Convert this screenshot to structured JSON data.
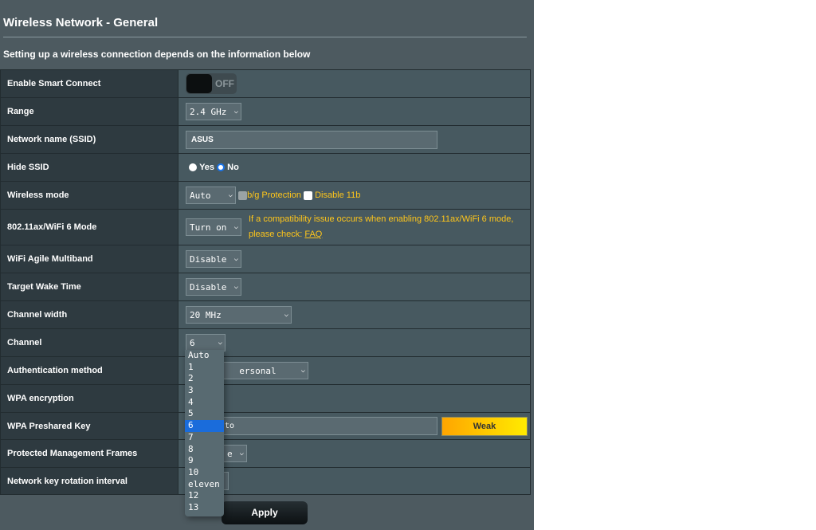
{
  "page": {
    "title": "Wireless Network - General",
    "subtitle": "Setting up a wireless connection depends on the information below"
  },
  "rows": {
    "smart_connect": {
      "label": "Enable Smart Connect",
      "toggle": "OFF",
      "on": false
    },
    "range": {
      "label": "Range",
      "value": "2.4 GHz"
    },
    "ssid": {
      "label": "Network name (SSID)",
      "value": "ASUS"
    },
    "hide_ssid": {
      "label": "Hide SSID",
      "yes": "Yes",
      "no": "No",
      "selected": "No"
    },
    "wireless_mode": {
      "label": "Wireless mode",
      "value": "Auto",
      "bg_protection": "b/g Protection",
      "bg_checked": true,
      "disable11b": "Disable 11b",
      "disable11b_checked": false
    },
    "ax_mode": {
      "label": "802.11ax/WiFi 6 Mode",
      "value": "Turn on",
      "note": "If a compatibility issue occurs when enabling 802.11ax/WiFi 6 mode,",
      "note2": "please check: ",
      "faq": "FAQ"
    },
    "agile": {
      "label": "WiFi Agile Multiband",
      "value": "Disable"
    },
    "twt": {
      "label": "Target Wake Time",
      "value": "Disable"
    },
    "width": {
      "label": "Channel width",
      "value": "20 MHz"
    },
    "channel": {
      "label": "Channel",
      "value": "6"
    },
    "auth": {
      "label": "Authentication method",
      "value": "ersonal"
    },
    "wpa_enc": {
      "label": "WPA encryption"
    },
    "psk": {
      "label": "WPA Preshared Key",
      "value": "to",
      "strength": "Weak"
    },
    "pmf": {
      "label": "Protected Management Frames",
      "value": "e"
    },
    "rotation": {
      "label": "Network key rotation interval"
    }
  },
  "channel_options": [
    "Auto",
    "1",
    "2",
    "3",
    "4",
    "5",
    "6",
    "7",
    "8",
    "9",
    "10",
    "eleven",
    "12",
    "13"
  ],
  "channel_selected": "6",
  "apply": "Apply",
  "colors": {
    "accent": "#ffc61a",
    "highlight": "#1a6cdb"
  }
}
